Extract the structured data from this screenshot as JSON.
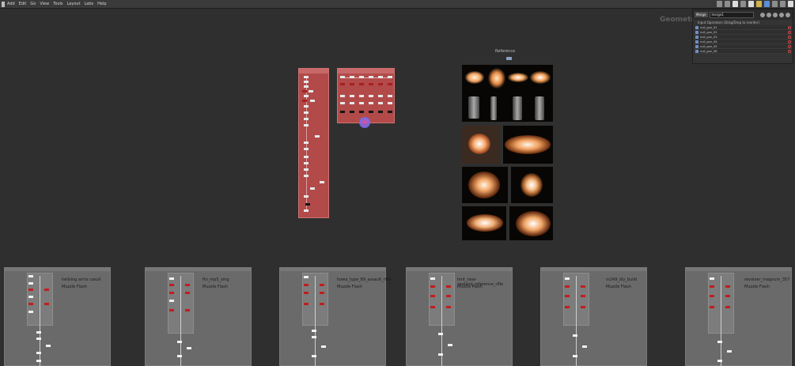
{
  "menubar": {
    "items": [
      "Add",
      "Edit",
      "Go",
      "View",
      "Tools",
      "Layout",
      "Labs",
      "Help"
    ]
  },
  "network_context": "Geometry",
  "parameter_panel": {
    "node_type": "Merge",
    "node_name": "merge1",
    "section_label": "Input Operators (Drag/Drop to reorder)",
    "inputs": [
      "null_gun_01",
      "null_gun_02",
      "null_gun_03",
      "null_gun_04",
      "null_gun_05",
      "null_gun_06"
    ]
  },
  "reference": {
    "label": "Reference"
  },
  "groups": [
    {
      "title": "hellsing arms casull",
      "subtitle": "Muzzle Flash"
    },
    {
      "title": "ftn_mp5_smg",
      "subtitle": "Muzzle Flash"
    },
    {
      "title": "howa_type_89_assault_rifle",
      "subtitle": "Muzzle Flash"
    },
    {
      "title": "hmt_new-zealand_reference_rifle",
      "subtitle": "Muzzle Flash"
    },
    {
      "title": "m249_diy_build",
      "subtitle": "Muzzle Flash"
    },
    {
      "title": "revolver_magnum_357",
      "subtitle": "Muzzle Flash"
    }
  ],
  "colors": {
    "network_bg": "#2f2f2f",
    "netbox_red": "#b24a4a",
    "group_gray": "#6a6a6a",
    "flash_orange": "#f0a060"
  }
}
